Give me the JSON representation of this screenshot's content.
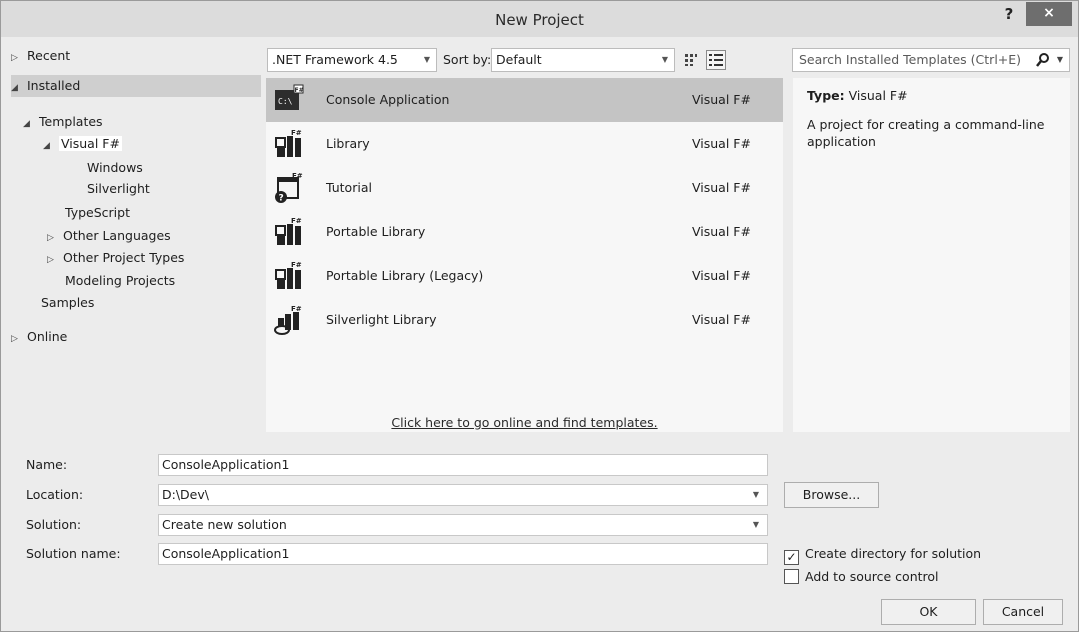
{
  "window": {
    "title": "New Project",
    "help_label": "?",
    "close_label": "×"
  },
  "tree": {
    "recent": "Recent",
    "installed": "Installed",
    "templates": "Templates",
    "visual_fsharp": "Visual F#",
    "windows": "Windows",
    "silverlight": "Silverlight",
    "typescript": "TypeScript",
    "other_languages": "Other Languages",
    "other_project_types": "Other Project Types",
    "modeling_projects": "Modeling Projects",
    "samples": "Samples",
    "online": "Online"
  },
  "toolbar": {
    "framework": ".NET Framework 4.5",
    "sort_label": "Sort by:",
    "sort_value": "Default"
  },
  "search": {
    "placeholder": "Search Installed Templates (Ctrl+E)"
  },
  "templates": [
    {
      "name": "Console Application",
      "language": "Visual F#",
      "icon": "console-app-icon",
      "selected": true
    },
    {
      "name": "Library",
      "language": "Visual F#",
      "icon": "library-icon"
    },
    {
      "name": "Tutorial",
      "language": "Visual F#",
      "icon": "tutorial-icon"
    },
    {
      "name": "Portable Library",
      "language": "Visual F#",
      "icon": "portable-library-icon"
    },
    {
      "name": "Portable Library (Legacy)",
      "language": "Visual F#",
      "icon": "portable-library-legacy-icon"
    },
    {
      "name": "Silverlight Library",
      "language": "Visual F#",
      "icon": "silverlight-library-icon"
    }
  ],
  "online_link": "Click here to go online and find templates.",
  "details": {
    "type_label": "Type:",
    "type_value": "Visual F#",
    "description": "A project for creating a command-line application"
  },
  "form": {
    "name_label": "Name:",
    "name_value": "ConsoleApplication1",
    "location_label": "Location:",
    "location_value": "D:\\Dev\\",
    "solution_label": "Solution:",
    "solution_value": "Create new solution",
    "solution_name_label": "Solution name:",
    "solution_name_value": "ConsoleApplication1",
    "browse_label": "Browse...",
    "create_dir_label": "Create directory for solution",
    "create_dir_checked": true,
    "source_control_label": "Add to source control",
    "source_control_checked": false,
    "ok_label": "OK",
    "cancel_label": "Cancel"
  }
}
